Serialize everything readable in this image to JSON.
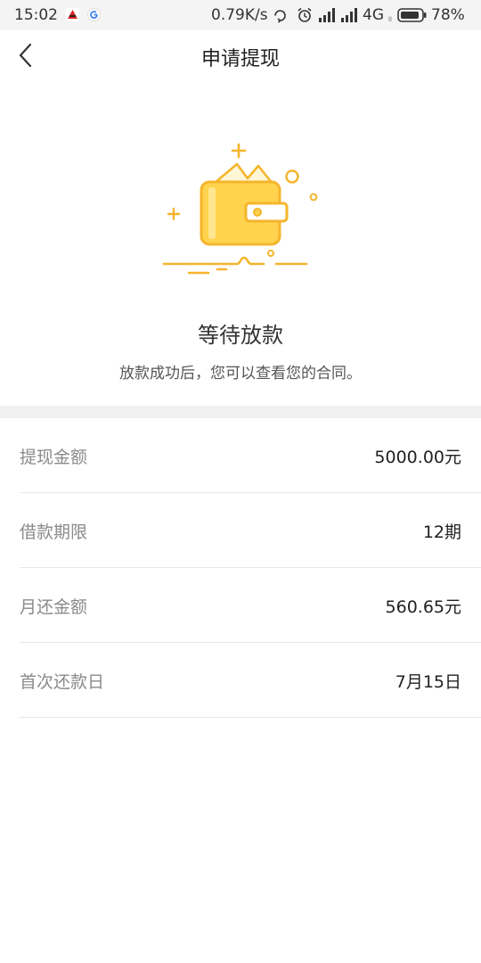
{
  "status_bar": {
    "time": "15:02",
    "net_speed": "0.79K/s",
    "network": "4G",
    "network_sub": "ll",
    "battery": "78%"
  },
  "nav": {
    "title": "申请提现"
  },
  "hero": {
    "status_title": "等待放款",
    "status_desc": "放款成功后，您可以查看您的合同。"
  },
  "details": [
    {
      "label": "提现金额",
      "value": "5000.00元"
    },
    {
      "label": "借款期限",
      "value": "12期"
    },
    {
      "label": "月还金额",
      "value": "560.65元"
    },
    {
      "label": "首次还款日",
      "value": "7月15日"
    }
  ],
  "colors": {
    "accent": "#f5b52c",
    "wallet_fill": "#ffd34d",
    "divider": "#f0f0f0"
  }
}
